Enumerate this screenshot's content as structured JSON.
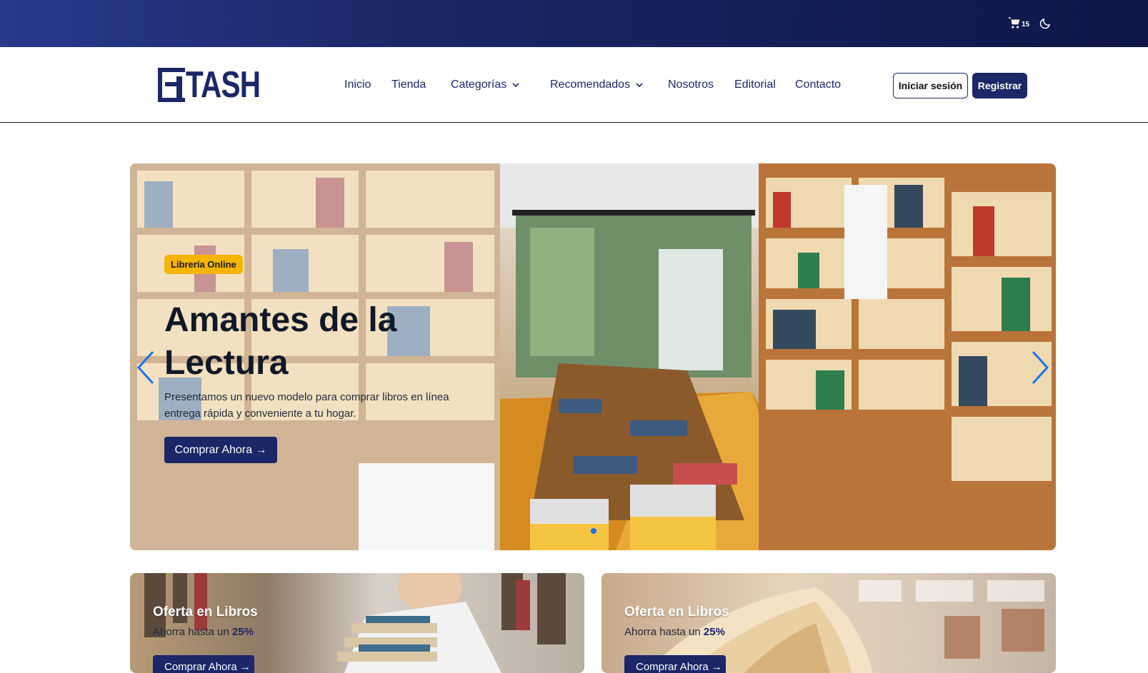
{
  "topbar": {
    "cart_count": "15",
    "icons": [
      "cart-icon",
      "moon-icon"
    ]
  },
  "header": {
    "logo_text": "TASH",
    "nav": [
      {
        "label": "Inicio"
      },
      {
        "label": "Tienda"
      },
      {
        "label": "Categorías",
        "dropdown": true
      },
      {
        "label": "Recomendados",
        "dropdown": true
      },
      {
        "label": "Nosotros"
      },
      {
        "label": "Editorial"
      },
      {
        "label": "Contacto"
      }
    ],
    "login_label": "Iniciar sesión",
    "register_label": "Registrar"
  },
  "hero": {
    "badge": "Librería Online",
    "title": "Amantes de la Lectura",
    "description": "Presentamos un nuevo modelo para comprar libros en línea entrega rápida y conveniente a tu hogar.",
    "cta": "Comprar Ahora →"
  },
  "offers": [
    {
      "title": "Oferta en Libros",
      "subtitle_prefix": "Ahorra hasta un",
      "discount": "25%",
      "button": "Comprar Ahora →"
    },
    {
      "title": "Oferta en Libros",
      "subtitle_prefix": "Ahorra hasta un",
      "discount": "25%",
      "button": "Comprar Ahora →"
    }
  ],
  "colors": {
    "brand": "#1b2767",
    "badge": "#f4b400",
    "carousel_arrow": "#1a73e8"
  }
}
